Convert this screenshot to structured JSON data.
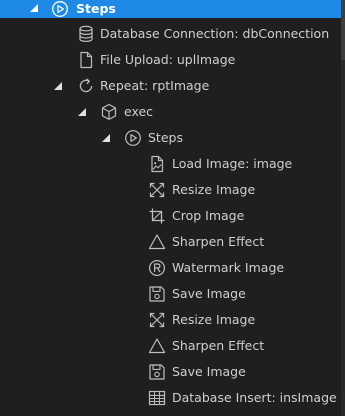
{
  "tree": {
    "steps_root": "Steps",
    "db_connection": "Database Connection: dbConnection",
    "file_upload": "File Upload: uplImage",
    "repeat": "Repeat: rptImage",
    "exec": "exec",
    "steps_inner": "Steps",
    "load_image": "Load Image: image",
    "resize_image_1": "Resize Image",
    "crop_image": "Crop Image",
    "sharpen_effect_1": "Sharpen Effect",
    "watermark_image": "Watermark Image",
    "save_image_1": "Save Image",
    "resize_image_2": "Resize Image",
    "sharpen_effect_2": "Sharpen Effect",
    "save_image_2": "Save Image",
    "database_insert": "Database Insert: insImage"
  },
  "colors": {
    "background": "#1f1f1f",
    "selection": "#1e8ae6",
    "text": "#cfcfcf",
    "icon": "#bdbdbd"
  },
  "icons": {
    "steps_root": "play-circle-icon",
    "db_connection": "database-icon",
    "file_upload": "file-icon",
    "repeat": "repeat-icon",
    "exec": "cube-icon",
    "steps_inner": "play-circle-icon",
    "load_image": "image-file-icon",
    "resize_image": "resize-icon",
    "crop_image": "crop-icon",
    "sharpen_effect": "triangle-icon",
    "watermark_image": "registered-icon",
    "save_image": "save-icon",
    "database_insert": "table-icon"
  }
}
